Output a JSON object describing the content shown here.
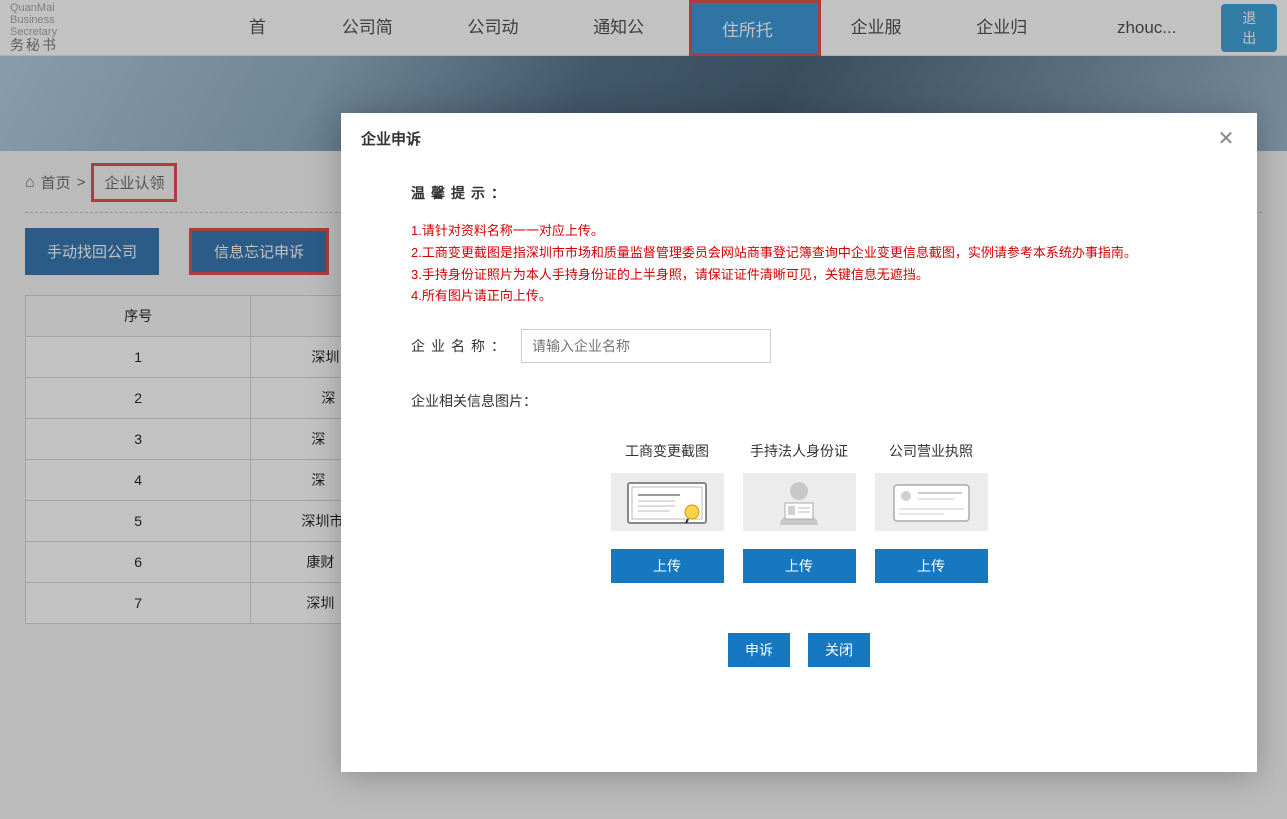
{
  "logo": {
    "en": "QuanMai Business Secretary",
    "cn": "务秘书"
  },
  "nav": {
    "items": [
      {
        "label": "首页"
      },
      {
        "label": "公司简介"
      },
      {
        "label": "公司动态"
      },
      {
        "label": "通知公告"
      },
      {
        "label": "住所托管"
      },
      {
        "label": "企业服务"
      },
      {
        "label": "企业归巢"
      }
    ]
  },
  "user": {
    "name": "zhouc..."
  },
  "logout": "退出",
  "breadcrumb": {
    "home": "首页",
    "sep": ">",
    "current": "企业认领"
  },
  "actions": {
    "find_company": "手动找回公司",
    "info_appeal": "信息忘记申诉"
  },
  "table": {
    "header_seq": "序号",
    "rows": [
      {
        "seq": "1",
        "name": "深圳"
      },
      {
        "seq": "2",
        "name": "深"
      },
      {
        "seq": "3",
        "name": "深"
      },
      {
        "seq": "4",
        "name": "深"
      },
      {
        "seq": "5",
        "name": "深圳市"
      },
      {
        "seq": "6",
        "name": "康财"
      },
      {
        "seq": "7",
        "name": "深圳"
      }
    ]
  },
  "modal": {
    "title": "企业申诉",
    "tips_title": "温馨提示：",
    "tips": [
      "1.请针对资料名称一一对应上传。",
      "2.工商变更截图是指深圳市市场和质量监督管理委员会网站商事登记簿查询中企业变更信息截图，实例请参考本系统办事指南。",
      "3.手持身份证照片为本人手持身份证的上半身照，请保证证件清晰可见，关键信息无遮挡。",
      "4.所有图片请正向上传。"
    ],
    "company_name_label": "企业名称：",
    "company_name_placeholder": "请输入企业名称",
    "upload_section_label": "企业相关信息图片：",
    "uploads": [
      {
        "label": "工商变更截图",
        "btn": "上传"
      },
      {
        "label": "手持法人身份证",
        "btn": "上传"
      },
      {
        "label": "公司营业执照",
        "btn": "上传"
      }
    ],
    "submit": "申诉",
    "close": "关闭"
  }
}
